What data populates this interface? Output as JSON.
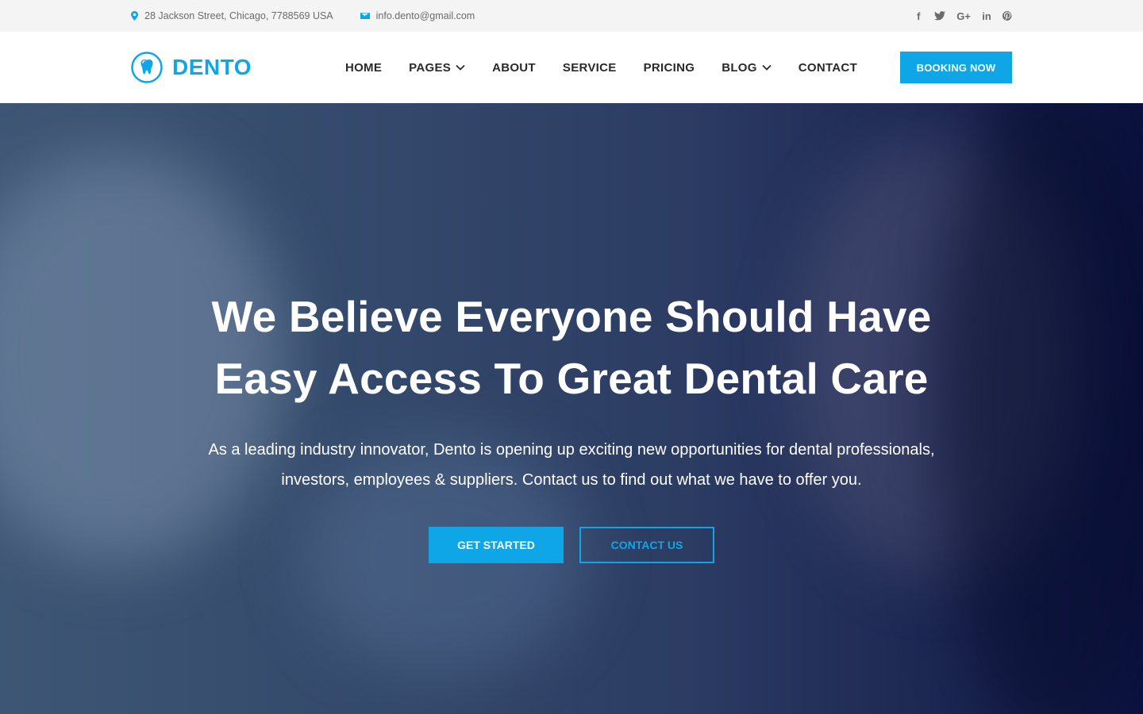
{
  "topbar": {
    "address": "28 Jackson Street, Chicago, 7788569 USA",
    "email": "info.dento@gmail.com",
    "socials": [
      {
        "icon": "facebook-icon",
        "glyph": "f"
      },
      {
        "icon": "twitter-icon",
        "glyph": ""
      },
      {
        "icon": "google-plus-icon",
        "glyph": "G+"
      },
      {
        "icon": "linkedin-icon",
        "glyph": "in"
      },
      {
        "icon": "pinterest-icon",
        "glyph": ""
      }
    ]
  },
  "header": {
    "logo_text": "DENTO",
    "nav": [
      {
        "label": "HOME",
        "dropdown": false
      },
      {
        "label": "PAGES",
        "dropdown": true
      },
      {
        "label": "ABOUT",
        "dropdown": false
      },
      {
        "label": "SERVICE",
        "dropdown": false
      },
      {
        "label": "PRICING",
        "dropdown": false
      },
      {
        "label": "BLOG",
        "dropdown": true
      },
      {
        "label": "CONTACT",
        "dropdown": false
      }
    ],
    "booking_label": "BOOKING NOW"
  },
  "hero": {
    "title_line1": "We Believe Everyone Should Have",
    "title_line2": "Easy Access To Great Dental Care",
    "subtitle_line1": "As a leading industry innovator, Dento is opening up exciting new opportunities for dental professionals,",
    "subtitle_line2": "investors, employees & suppliers. Contact us to find out what we have to offer you.",
    "primary_button": "GET STARTED",
    "secondary_button": "CONTACT US"
  },
  "colors": {
    "accent": "#0fa6e8",
    "topbar_bg": "#f4f4f4",
    "hero_overlay": "#2c3c63"
  }
}
